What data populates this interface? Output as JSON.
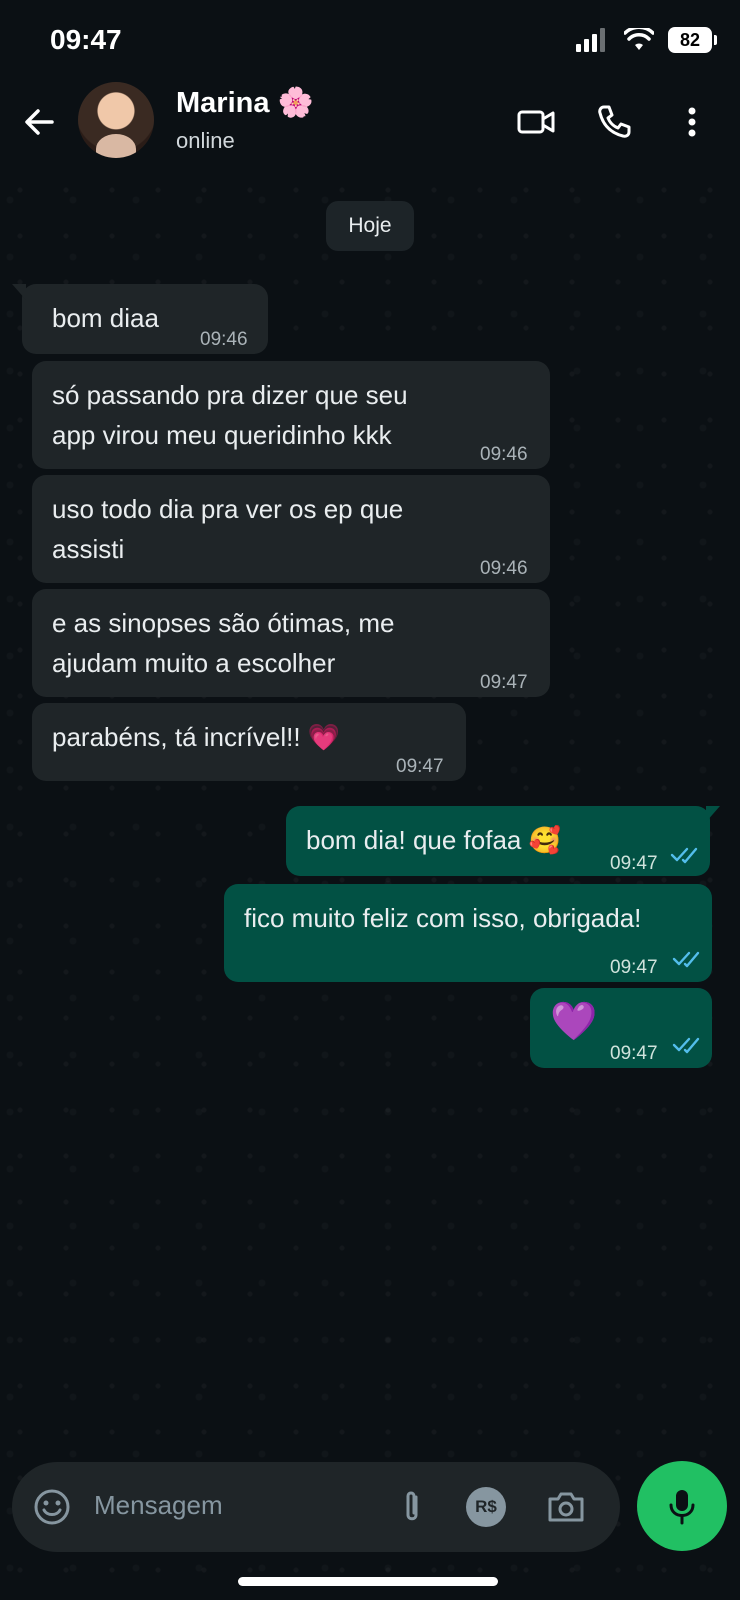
{
  "status_bar": {
    "time": "09:47",
    "battery": "82"
  },
  "header": {
    "name": "Marina 🌸",
    "status": "online"
  },
  "date_chip": "Hoje",
  "messages": [
    {
      "dir": "in",
      "lines": [
        "bom diaa"
      ],
      "time": "09:46"
    },
    {
      "dir": "in",
      "lines": [
        "só passando pra dizer que seu",
        "app virou meu queridinho kkk"
      ],
      "time": "09:46"
    },
    {
      "dir": "in",
      "lines": [
        "uso todo dia pra ver os ep que",
        "assisti"
      ],
      "time": "09:46"
    },
    {
      "dir": "in",
      "lines": [
        "e as sinopses são ótimas, me",
        "ajudam muito a escolher"
      ],
      "time": "09:47"
    },
    {
      "dir": "in",
      "lines": [
        "parabéns, tá incrível!! 💗"
      ],
      "time": "09:47"
    },
    {
      "dir": "out",
      "lines": [
        "bom dia! que fofaa 🥰"
      ],
      "time": "09:47",
      "read": true
    },
    {
      "dir": "out",
      "lines": [
        "fico muito feliz com isso, obrigada!"
      ],
      "time": "09:47",
      "read": true
    },
    {
      "dir": "out",
      "lines": [
        "💜"
      ],
      "time": "09:47",
      "read": true
    }
  ],
  "input": {
    "placeholder": "Mensagem"
  },
  "icons": {
    "back": "arrow-left-icon",
    "video": "video-call-icon",
    "call": "phone-icon",
    "menu": "more-vert-icon",
    "emoji": "emoji-icon",
    "attach": "paperclip-icon",
    "payment": "payment-rs-icon",
    "camera": "camera-icon",
    "mic": "mic-icon",
    "payment_label": "R$"
  },
  "colors": {
    "incoming": "#1f2528",
    "outgoing": "#025144",
    "accent": "#21c063",
    "read_tick": "#53bdeb"
  }
}
